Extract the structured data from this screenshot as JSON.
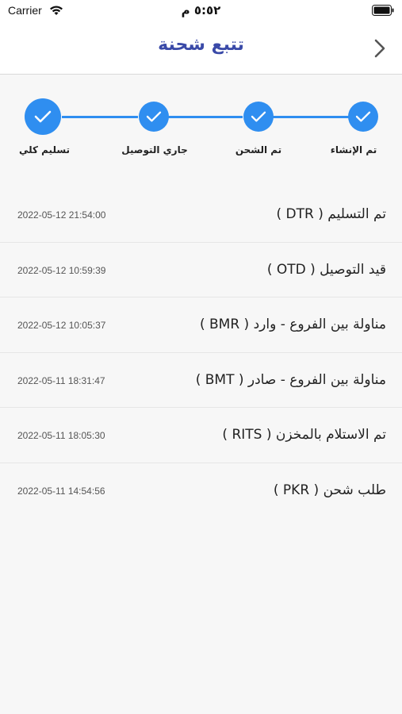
{
  "status_bar": {
    "carrier": "Carrier",
    "time": "٥:٥٢ م"
  },
  "nav": {
    "title": "تتبع شحنة",
    "back_icon": "chevron-right-icon"
  },
  "steps": [
    {
      "label": "تم الإنشاء",
      "done": true
    },
    {
      "label": "تم الشحن",
      "done": true
    },
    {
      "label": "جاري التوصيل",
      "done": true
    },
    {
      "label": "تسليم كلي",
      "done": true
    }
  ],
  "events": [
    {
      "title": "تم التسليم  ( DTR )",
      "time": "2022-05-12 21:54:00"
    },
    {
      "title": "قيد التوصيل  ( OTD )",
      "time": "2022-05-12 10:59:39"
    },
    {
      "title": "مناولة بين الفروع - وارد  ( BMR )",
      "time": "2022-05-12 10:05:37"
    },
    {
      "title": "مناولة بين الفروع - صادر  ( BMT )",
      "time": "2022-05-11 18:31:47"
    },
    {
      "title": "تم الاستلام بالمخزن  ( RITS )",
      "time": "2022-05-11 18:05:30"
    },
    {
      "title": "طلب شحن  ( PKR )",
      "time": "2022-05-11 14:54:56"
    }
  ],
  "colors": {
    "accent": "#2f8ef0",
    "title": "#3a4aa8"
  }
}
